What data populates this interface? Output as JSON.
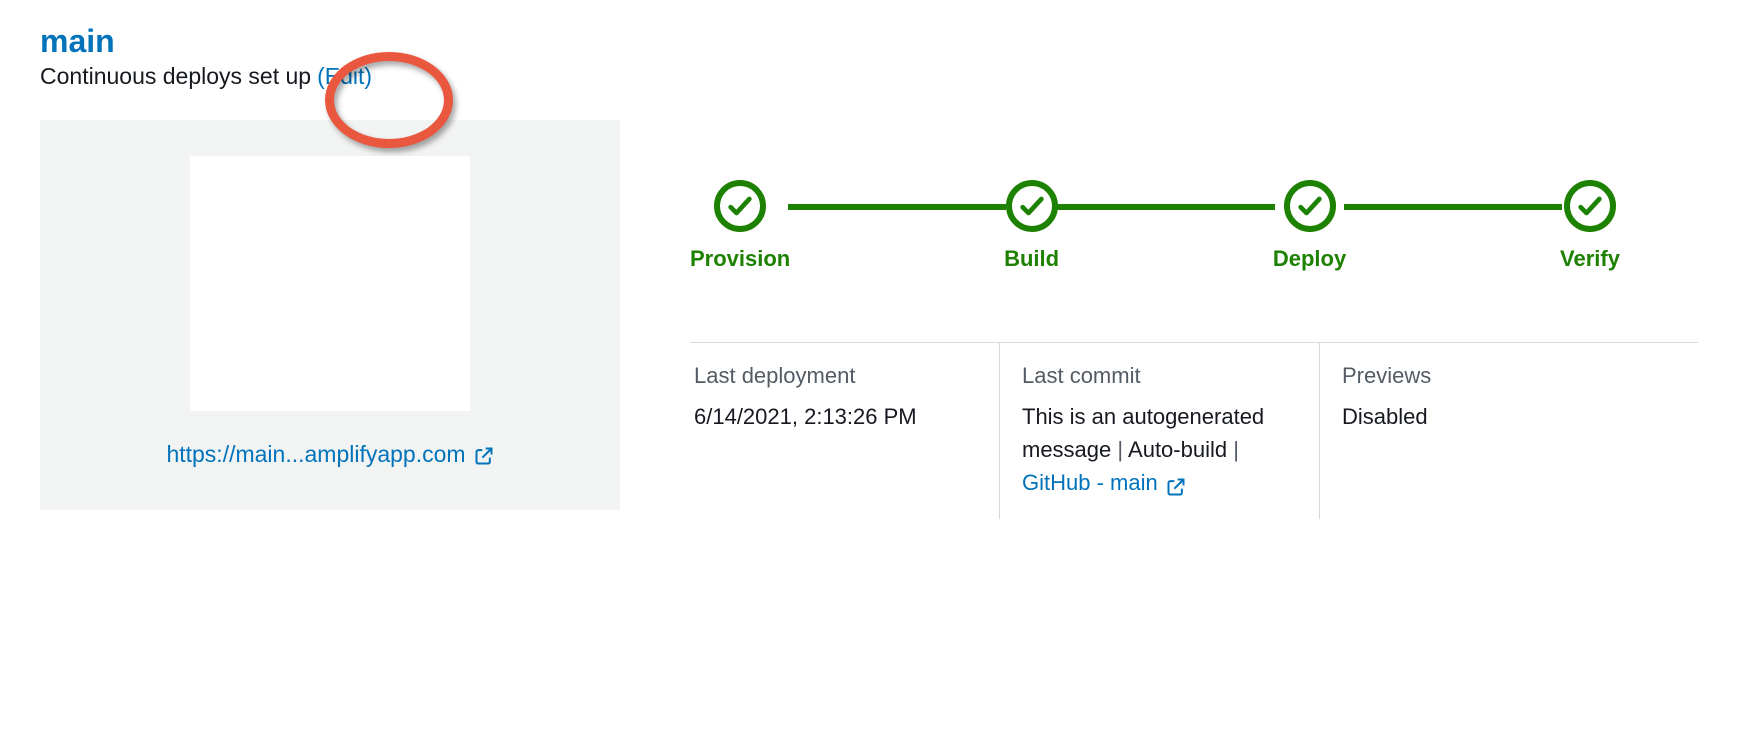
{
  "colors": {
    "link": "#0073bb",
    "success": "#1d8102",
    "annotation": "#e9573f"
  },
  "header": {
    "branch": "main",
    "deploy_status_text": "Continuous deploys set up",
    "edit_label": "(Edit)"
  },
  "preview": {
    "url_text": "https://main...amplifyapp.com"
  },
  "pipeline": {
    "stages": [
      "Provision",
      "Build",
      "Deploy",
      "Verify"
    ]
  },
  "details": {
    "last_deployment": {
      "label": "Last deployment",
      "value": "6/14/2021, 2:13:26 PM"
    },
    "last_commit": {
      "label": "Last commit",
      "message": "This is an autogenerated message",
      "separator": "|",
      "autobuild": "Auto-build",
      "source_link": "GitHub - main"
    },
    "previews": {
      "label": "Previews",
      "value": "Disabled"
    }
  }
}
